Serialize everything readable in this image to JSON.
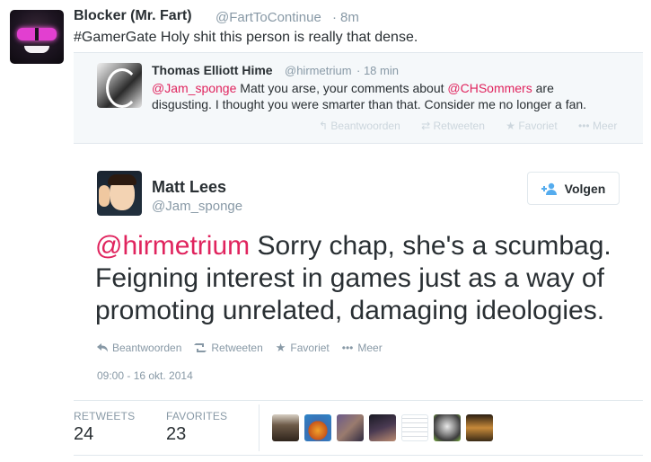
{
  "outer": {
    "name": "Blocker (Mr. Fart)",
    "handle": "@FartToContinue",
    "dot": "·",
    "time": "8m",
    "hashtag": "#GamerGate",
    "text": " Holy shit this person is really that dense."
  },
  "quoted": {
    "name": "Thomas Elliott Hime",
    "handle": "@hirmetrium",
    "time": "· 18 min",
    "mention1": "@Jam_sponge",
    "text1": " Matt you arse, your comments about ",
    "mention2": "@CHSommers",
    "text2": " are",
    "line2": "disgusting. I thought you were smarter than that. Consider me no longer a fan.",
    "actions": [
      "Beantwoorden",
      "Retweeten",
      "Favoriet",
      "Meer"
    ]
  },
  "main": {
    "name": "Matt Lees",
    "handle": "@Jam_sponge",
    "follow_label": "Volgen",
    "mention": "@hirmetrium",
    "text": " Sorry chap, she's a scumbag. Feigning interest in games just as a way of promoting unrelated, damaging ideologies.",
    "actions": [
      "Beantwoorden",
      "Retweeten",
      "Favoriet",
      "Meer"
    ],
    "date": "09:00 - 16 okt. 2014"
  },
  "stats": {
    "retweets_label": "RETWEETS",
    "retweets": "24",
    "favorites_label": "FAVORITES",
    "favorites": "23"
  },
  "colors": {
    "mention": "#e0245e",
    "muted": "#8899a6",
    "text": "#292f33",
    "follow_icon": "#55acee"
  }
}
